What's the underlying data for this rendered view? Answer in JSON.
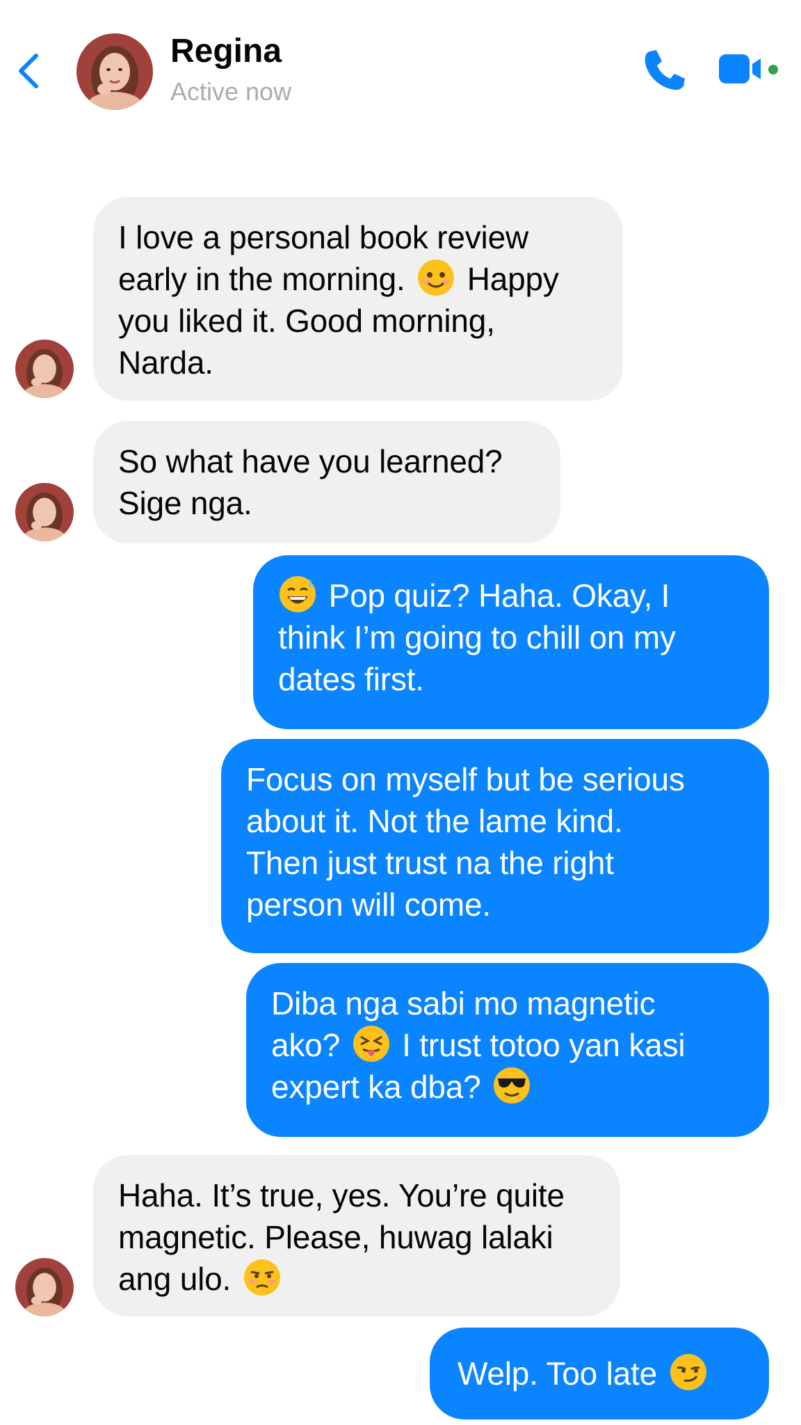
{
  "header": {
    "name": "Regina",
    "status": "Active now",
    "icons": {
      "back": "chevron-left-icon",
      "call": "phone-icon",
      "video": "video-camera-icon"
    },
    "accent_color": "#0a84ff",
    "online_color": "#31a24c"
  },
  "messages": [
    {
      "direction": "in",
      "lines": [
        "I love a personal book review",
        "early in the morning.",
        "Happy",
        "you liked it. Good morning,",
        "Narda."
      ],
      "emoji": [
        "smiling-face-emoji"
      ]
    },
    {
      "direction": "in",
      "lines": [
        "So what have you learned?",
        "Sige nga."
      ]
    },
    {
      "direction": "out",
      "lines": [
        "Pop quiz? Haha. Okay, I",
        "think I’m going to chill on my",
        "dates first."
      ],
      "emoji": [
        "grinning-sweat-emoji"
      ]
    },
    {
      "direction": "out",
      "lines": [
        "Focus on myself but be serious",
        "about it. Not the lame kind.",
        "Then just trust na the right",
        "person will come."
      ]
    },
    {
      "direction": "out",
      "lines": [
        "Diba nga sabi mo magnetic",
        "ako?",
        "I trust totoo yan kasi",
        "expert ka dba?"
      ],
      "emoji": [
        "squinting-tongue-emoji",
        "sunglasses-face-emoji"
      ]
    },
    {
      "direction": "in",
      "lines": [
        "Haha. It’s true, yes. You’re quite",
        "magnetic. Please, huwag lalaki",
        "ang ulo."
      ],
      "emoji": [
        "unamused-face-emoji"
      ]
    },
    {
      "direction": "out",
      "lines": [
        "Welp. Too late"
      ],
      "emoji": [
        "smirking-face-emoji"
      ]
    }
  ]
}
